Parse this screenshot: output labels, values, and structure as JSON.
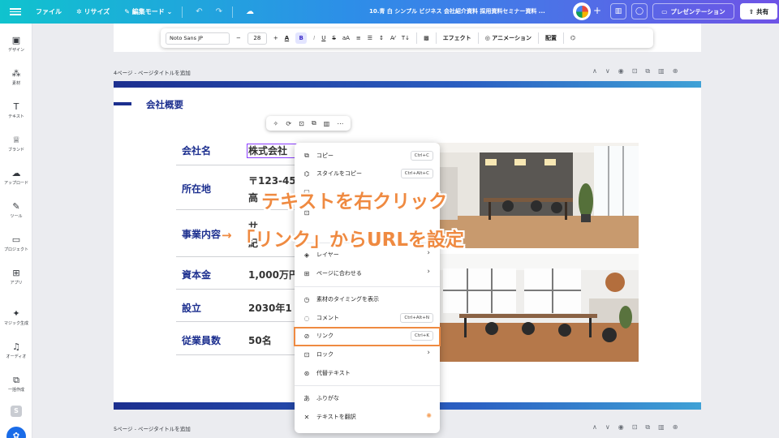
{
  "topbar": {
    "file": "ファイル",
    "resize": "リサイズ",
    "edit_mode": "編集モード",
    "doc_title": "10.青 白 シンプル ビジネス 会社紹介資料 採用資料セミナー資料 ...",
    "present": "プレゼンテーション",
    "share": "共有"
  },
  "sidebar": [
    {
      "label": "デザイン",
      "icon": "design-icon"
    },
    {
      "label": "素材",
      "icon": "elements-icon"
    },
    {
      "label": "テキスト",
      "icon": "text-icon"
    },
    {
      "label": "ブランド",
      "icon": "brand-icon"
    },
    {
      "label": "アップロード",
      "icon": "upload-icon"
    },
    {
      "label": "ツール",
      "icon": "draw-icon"
    },
    {
      "label": "プロジェクト",
      "icon": "folder-icon"
    },
    {
      "label": "アプリ",
      "icon": "apps-icon"
    },
    {
      "label": "マジック生成",
      "icon": "magic-icon"
    },
    {
      "label": "オーディオ",
      "icon": "music-icon"
    },
    {
      "label": "一括作成",
      "icon": "bulk-create-icon"
    }
  ],
  "sidebar_badge": "S",
  "format_toolbar": {
    "font": "Noto Sans JP",
    "minus": "−",
    "size": "28",
    "plus": "+",
    "bold": "B",
    "italic": "I",
    "underline": "U",
    "strike": "S",
    "case": "aA",
    "effect": "エフェクト",
    "animation": "アニメーション",
    "position": "配置"
  },
  "pages": {
    "page4_label": "4ページ - ページタイトルを追加",
    "page5_label": "5ページ - ページタイトルを追加"
  },
  "slide": {
    "heading": "会社概要",
    "rows": [
      {
        "label": "会社名",
        "value": "株式会社"
      },
      {
        "label": "所在地",
        "value": "〒123-45",
        "value2": "高"
      },
      {
        "label": "事業内容",
        "value": "サ",
        "value2": "紀"
      },
      {
        "label": "資本金",
        "value": "1,000万円"
      },
      {
        "label": "設立",
        "value": "2030年1"
      },
      {
        "label": "従業員数",
        "value": "50名"
      }
    ]
  },
  "context_menu": [
    {
      "label": "コピー",
      "shortcut": "Ctrl+C",
      "icon": "copy-icon"
    },
    {
      "label": "スタイルをコピー",
      "shortcut": "Ctrl+Alt+C",
      "icon": "paint-roller-icon"
    },
    {
      "label": "レイヤー",
      "icon": "layers-icon"
    },
    {
      "label": "ページに合わせる",
      "icon": "fit-page-icon"
    },
    {
      "label": "素材のタイミングを表示",
      "icon": "clock-icon"
    },
    {
      "label": "コメント",
      "shortcut": "Ctrl+Alt+N",
      "icon": "comment-icon"
    },
    {
      "label": "リンク",
      "shortcut": "Ctrl+K",
      "icon": "link-icon"
    },
    {
      "label": "ロック",
      "icon": "lock-icon"
    },
    {
      "label": "代替テキスト",
      "icon": "accessibility-icon"
    },
    {
      "label": "ふりがな",
      "icon": "furigana-icon"
    },
    {
      "label": "テキストを翻訳",
      "icon": "translate-icon"
    }
  ],
  "annotation": {
    "line1": "テキストを右クリック",
    "line2": "「リンク」からURLを設定"
  },
  "colors": {
    "accent_orange": "#ef8a41",
    "brand_navy": "#1c2f8f",
    "canva_purple": "#8b3dff"
  }
}
